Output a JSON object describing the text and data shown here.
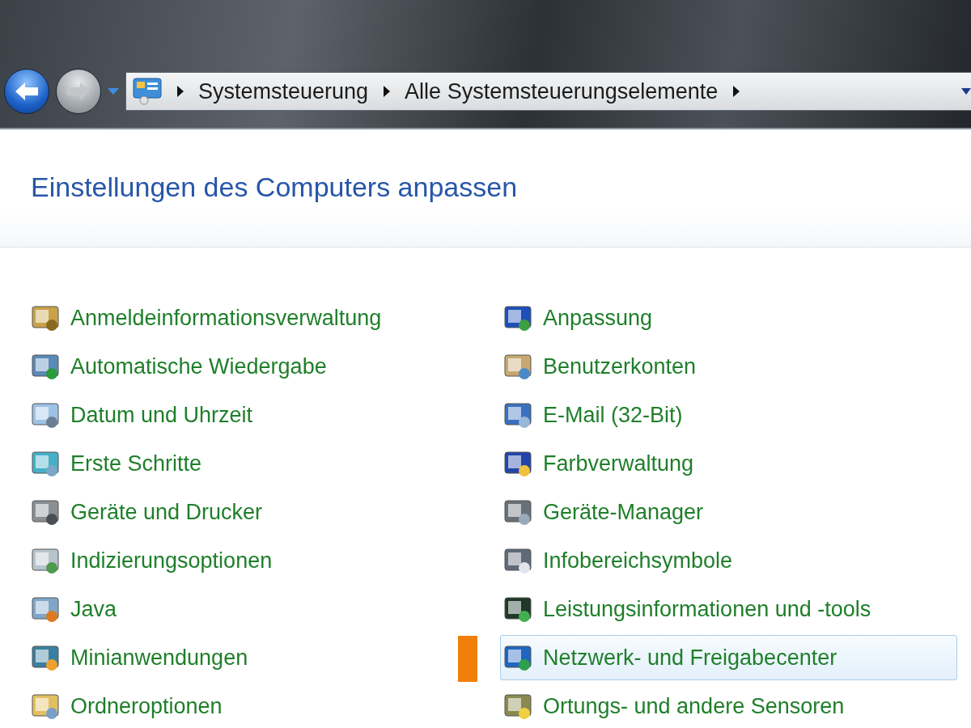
{
  "toolbar": {
    "back": {
      "disabled": false
    },
    "forward": {
      "disabled": true
    },
    "breadcrumbs": [
      "Systemsteuerung",
      "Alle Systemsteuerungselemente"
    ]
  },
  "heading": "Einstellungen des Computers anpassen",
  "columns": [
    {
      "items": [
        {
          "label": "Anmeldeinformationsverwaltung",
          "selected": false,
          "marked": false
        },
        {
          "label": "Automatische Wiedergabe",
          "selected": false,
          "marked": false
        },
        {
          "label": "Datum und Uhrzeit",
          "selected": false,
          "marked": false
        },
        {
          "label": "Erste Schritte",
          "selected": false,
          "marked": false
        },
        {
          "label": "Geräte und Drucker",
          "selected": false,
          "marked": false
        },
        {
          "label": "Indizierungsoptionen",
          "selected": false,
          "marked": false
        },
        {
          "label": "Java",
          "selected": false,
          "marked": false
        },
        {
          "label": "Minianwendungen",
          "selected": false,
          "marked": false
        },
        {
          "label": "Ordneroptionen",
          "selected": false,
          "marked": false
        }
      ]
    },
    {
      "items": [
        {
          "label": "Anpassung",
          "selected": false,
          "marked": false
        },
        {
          "label": "Benutzerkonten",
          "selected": false,
          "marked": false
        },
        {
          "label": "E-Mail (32-Bit)",
          "selected": false,
          "marked": false
        },
        {
          "label": "Farbverwaltung",
          "selected": false,
          "marked": false
        },
        {
          "label": "Geräte-Manager",
          "selected": false,
          "marked": false
        },
        {
          "label": "Infobereichsymbole",
          "selected": false,
          "marked": false
        },
        {
          "label": "Leistungsinformationen und -tools",
          "selected": false,
          "marked": false
        },
        {
          "label": "Netzwerk- und Freigabecenter",
          "selected": true,
          "marked": true
        },
        {
          "label": "Ortungs- und andere Sensoren",
          "selected": false,
          "marked": false
        }
      ]
    }
  ]
}
